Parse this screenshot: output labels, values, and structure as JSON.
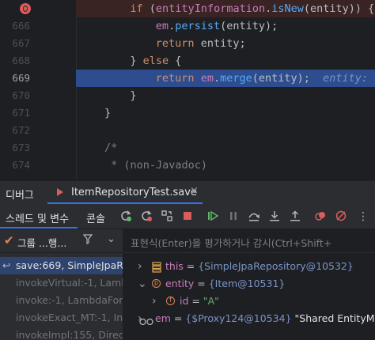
{
  "editor": {
    "lines": [
      {
        "num": "",
        "code_parts": [
          [
            "kw",
            "if "
          ],
          [
            "",
            "("
          ],
          [
            "fld",
            "entityInformation"
          ],
          [
            "",
            "."
          ],
          [
            "fn",
            "isNew"
          ],
          [
            "",
            "(entity)) {"
          ]
        ],
        "indent": 8
      },
      {
        "num": "666",
        "code_parts": [
          [
            "fld",
            "em"
          ],
          [
            "",
            "."
          ],
          [
            "fn",
            "persist"
          ],
          [
            "",
            "(entity);"
          ]
        ],
        "indent": 12
      },
      {
        "num": "667",
        "code_parts": [
          [
            "kw",
            "return "
          ],
          [
            "",
            "entity;"
          ]
        ],
        "indent": 12
      },
      {
        "num": "668",
        "code_parts": [
          [
            "",
            "} "
          ],
          [
            "kw",
            "else "
          ],
          [
            "",
            "{"
          ]
        ],
        "indent": 8
      },
      {
        "num": "669",
        "code_parts": [
          [
            "kw",
            "return "
          ],
          [
            "fld",
            "em"
          ],
          [
            "",
            "."
          ],
          [
            "fn",
            "merge"
          ],
          [
            "",
            "(entity);  "
          ],
          [
            "hint",
            "entity: "
          ]
        ],
        "indent": 12
      },
      {
        "num": "670",
        "code_parts": [
          [
            "",
            "}"
          ]
        ],
        "indent": 8
      },
      {
        "num": "671",
        "code_parts": [
          [
            "",
            "}"
          ]
        ],
        "indent": 4
      },
      {
        "num": "672",
        "code_parts": [],
        "indent": 0
      },
      {
        "num": "673",
        "code_parts": [
          [
            "cm",
            "/*"
          ]
        ],
        "indent": 4
      },
      {
        "num": "674",
        "code_parts": [
          [
            "cm",
            " * (non-Javadoc)"
          ]
        ],
        "indent": 4
      }
    ]
  },
  "debug": {
    "title": "디버그",
    "tab_label": "ItemRepositoryTest.save",
    "tab_close": "×",
    "toolbar": {
      "threads_label": "스레드 및 변수",
      "console_label": "콘솔"
    },
    "frames": {
      "header_text": "그룹 ...행...",
      "items": [
        {
          "text": "save:669, SimpleJpaR",
          "selected": true
        },
        {
          "text": "invokeVirtual:-1, Lamb",
          "selected": false
        },
        {
          "text": "invoke:-1, LambdaFor",
          "selected": false
        },
        {
          "text": "invokeExact_MT:-1, In",
          "selected": false
        },
        {
          "text": "invokeImpl:155, Direct",
          "selected": false
        }
      ]
    },
    "variables": {
      "eval_placeholder": "표현식(Enter)을 평가하거나 감시(Ctrl+Shift+",
      "items": [
        {
          "name": "this",
          "value": "{SimpleJpaRepository@10532}",
          "icon": "field-list-icon",
          "expanded": false,
          "level": 0
        },
        {
          "name": "entity",
          "value": "{Item@10531}",
          "icon": "parameter-icon",
          "expanded": true,
          "level": 0
        },
        {
          "name": "id",
          "value": "\"A\"",
          "icon": "field-icon",
          "expanded": false,
          "level": 1
        },
        {
          "name": "em",
          "value": "{$Proxy124@10534}",
          "extra": "\"Shared EntityM",
          "icon": "watch-icon",
          "expanded": false,
          "level": 0
        }
      ]
    }
  },
  "colors": {
    "editor_bg": "#1e1f22",
    "exec_line": "#2d4d8f",
    "breakpoint": "#db5c5c",
    "selection": "#2e436e"
  }
}
